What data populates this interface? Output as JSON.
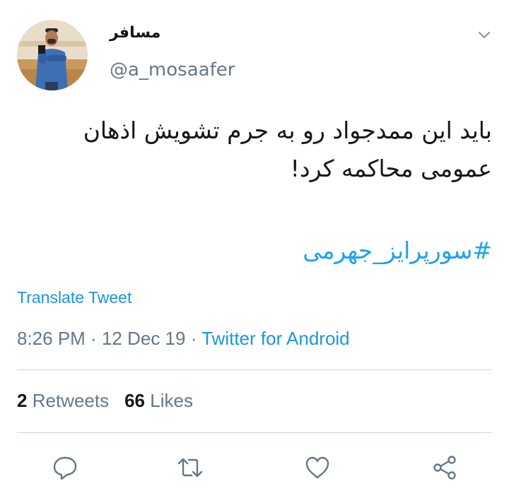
{
  "tweet": {
    "author": {
      "display_name": "مسافر",
      "handle": "@a_mosaafer"
    },
    "text_line1": "باید این ممدجواد رو به جرم تشویش اذهان",
    "text_line2": "عمومی محاکمه کرد!",
    "hashtag": "#سورپرایز_جهرمی",
    "translate_label": "Translate Tweet",
    "time": "8:26 PM",
    "separator": " · ",
    "date": "12 Dec 19",
    "source": "Twitter for Android",
    "retweets_count": "2",
    "retweets_label": "Retweets",
    "likes_count": "66",
    "likes_label": "Likes"
  },
  "icons": {
    "menu": "chevron-down-icon",
    "reply": "reply-icon",
    "retweet": "retweet-icon",
    "like": "like-heart-icon",
    "share": "share-icon"
  },
  "colors": {
    "accent": "#1da1f2",
    "link": "#1b95e0",
    "text": "#14171a",
    "secondary": "#657786",
    "divider": "#ccd6dd"
  }
}
